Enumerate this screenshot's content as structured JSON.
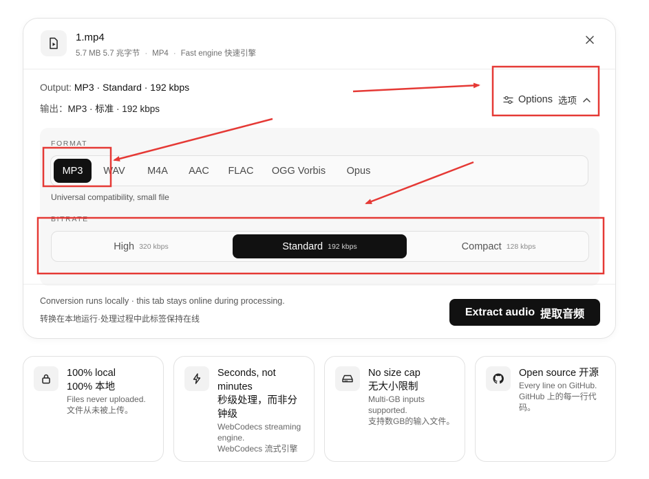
{
  "file": {
    "name": "1.mp4",
    "size": "5.7 MB 5.7 兆字节",
    "container": "MP4",
    "engine": "Fast engine 快速引擎",
    "icon": "file-play-icon"
  },
  "output": {
    "label": "Output:",
    "value": "MP3 · Standard · 192 kbps",
    "label_cn": "输出：",
    "value_cn": "MP3 · 标准 · 192 kbps"
  },
  "options": {
    "label": "Options",
    "label_cn": "选项",
    "expanded": true
  },
  "format": {
    "section_label": "FORMAT",
    "items": [
      "MP3",
      "WAV",
      "M4A",
      "AAC",
      "FLAC",
      "OGG Vorbis",
      "Opus"
    ],
    "selected": "MP3",
    "description": "Universal compatibility, small file"
  },
  "bitrate": {
    "section_label": "BITRATE",
    "items": [
      {
        "label": "High",
        "sub": "320 kbps"
      },
      {
        "label": "Standard",
        "sub": "192 kbps"
      },
      {
        "label": "Compact",
        "sub": "128 kbps"
      }
    ],
    "selected": "Standard"
  },
  "footer": {
    "note": "Conversion runs locally · this tab stays online during processing.",
    "note_cn": "转换在本地运行·处理过程中此标签保持在线",
    "extract_label": "Extract audio",
    "extract_label_cn": "提取音频"
  },
  "features": [
    {
      "icon": "lock-icon",
      "title": "100% local",
      "title_cn": "100% 本地",
      "desc": "Files never uploaded.",
      "desc_cn": "文件从未被上传。"
    },
    {
      "icon": "lightning-icon",
      "title": "Seconds, not minutes",
      "title_cn": "秒级处理，而非分钟级",
      "desc": "WebCodecs streaming engine.",
      "desc_cn": "WebCodecs 流式引擎"
    },
    {
      "icon": "drive-icon",
      "title": "No size cap",
      "title_cn": "无大小限制",
      "desc": "Multi-GB inputs supported.",
      "desc_cn": "支持数GB的输入文件。"
    },
    {
      "icon": "github-icon",
      "title": "Open source 开源",
      "title_cn": "",
      "desc": "Every line on GitHub.",
      "desc_cn": "GitHub 上的每一行代码。"
    }
  ],
  "colors": {
    "accent": "#111111",
    "annotation": "#e53935",
    "panel": "#f7f7f7"
  }
}
